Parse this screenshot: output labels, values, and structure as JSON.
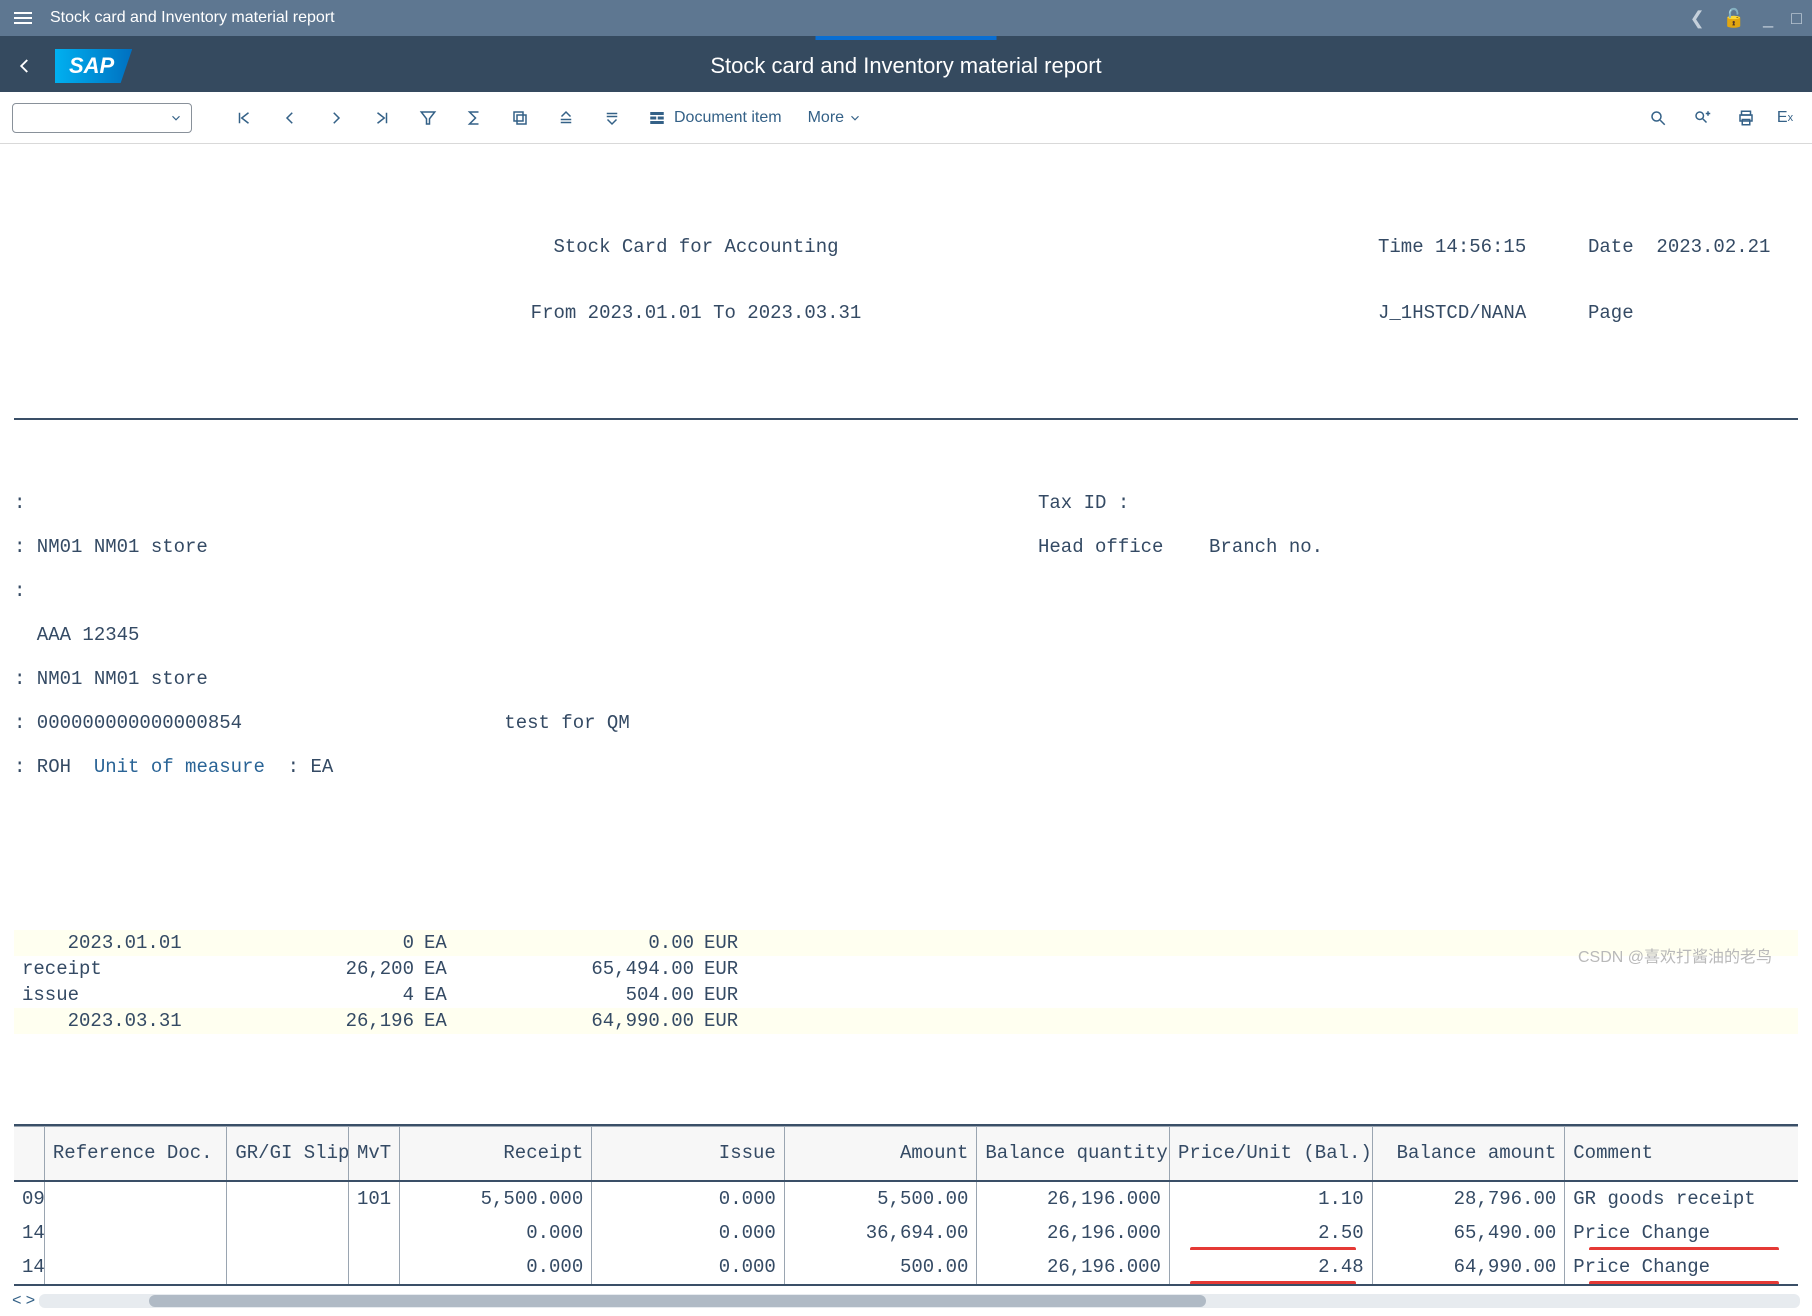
{
  "titlebar": {
    "title": "Stock card and Inventory material report"
  },
  "header": {
    "title": "Stock card and Inventory material report",
    "logo": "SAP"
  },
  "toolbar": {
    "document_item": "Document item",
    "more": "More"
  },
  "report_header": {
    "title": "Stock Card for Accounting",
    "daterange": "From 2023.01.01 To 2023.03.31",
    "time_label": "Time",
    "time": "14:56:15",
    "date_label": "Date",
    "date": "2023.02.21",
    "prog": "J_1HSTCD/NANA",
    "page_label": "Page"
  },
  "info": {
    "taxid": "Tax ID :",
    "headoffice": "Head office",
    "branch": "Branch no.",
    "l1": ":",
    "l2": ": NM01 NM01 store",
    "l3": ":",
    "l4": "  AAA 12345",
    "l5": ": NM01 NM01 store",
    "l6a": ": 000000000000000854",
    "l6b": "test for QM",
    "l7a": ": ROH  ",
    "l7link": "Unit of measure",
    "l7b": "  : EA"
  },
  "summary": [
    {
      "c1": "    2023.01.01",
      "c2": "0",
      "c3": "EA",
      "c4": "0.00",
      "c5": "EUR",
      "yellow": true
    },
    {
      "c1": "receipt",
      "c2": "26,200",
      "c3": "EA",
      "c4": "65,494.00",
      "c5": "EUR",
      "yellow": false
    },
    {
      "c1": "issue",
      "c2": "4",
      "c3": "EA",
      "c4": "504.00",
      "c5": "EUR",
      "yellow": false
    },
    {
      "c1": "    2023.03.31",
      "c2": "26,196",
      "c3": "EA",
      "c4": "64,990.00",
      "c5": "EUR",
      "yellow": true
    }
  ],
  "columns": [
    "",
    "Reference Doc.",
    "GR/GI Slip",
    "MvT",
    "Receipt",
    "Issue",
    "Amount",
    "Balance quantity",
    "Price/Unit (Bal.)",
    "Balance amount",
    "Comment"
  ],
  "col_align": [
    "",
    "",
    "",
    "",
    "num",
    "num",
    "num",
    "num",
    "num",
    "num",
    ""
  ],
  "rows": [
    {
      "cells": [
        "09",
        "",
        "",
        "101",
        "5,500.000",
        "0.000",
        "5,500.00",
        "26,196.000",
        "1.10",
        "28,796.00",
        "GR goods receipt"
      ],
      "marks": {}
    },
    {
      "cells": [
        "14",
        "",
        "",
        "",
        "0.000",
        "0.000",
        "36,694.00",
        "26,196.000",
        "2.50",
        "65,490.00",
        "Price Change"
      ],
      "marks": {
        "8": true,
        "10": true
      }
    },
    {
      "cells": [
        "14",
        "",
        "",
        "",
        "0.000",
        "0.000",
        "500.00",
        "26,196.000",
        "2.48",
        "64,990.00",
        "Price Change"
      ],
      "marks": {
        "8": true,
        "10": true
      }
    }
  ],
  "watermark": "CSDN @喜欢打酱油的老鸟"
}
